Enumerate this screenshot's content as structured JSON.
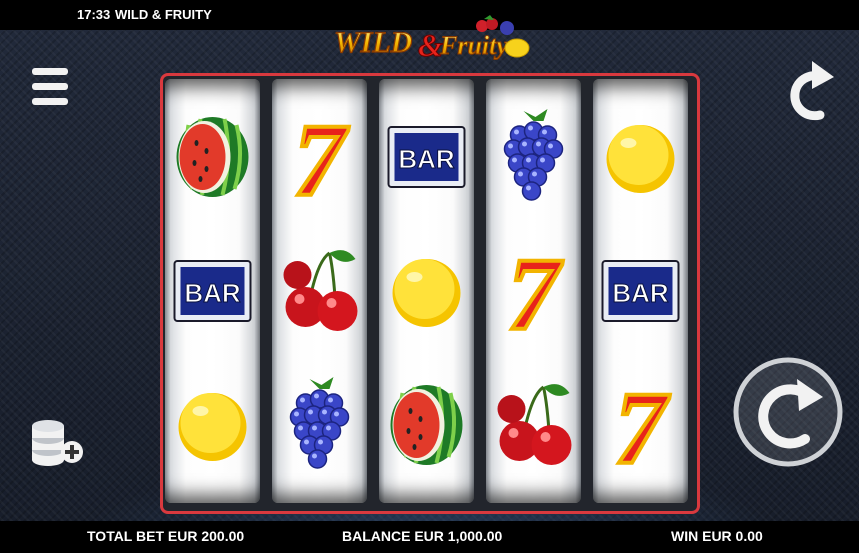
{
  "status_bar": {
    "time": "17:33",
    "game_title": "WILD & FRUITY"
  },
  "logo": {
    "text_wild": "WILD",
    "text_amp": "&",
    "text_fruity": "Fruity"
  },
  "reels": [
    [
      "watermelon",
      "bar",
      "lemon"
    ],
    [
      "seven",
      "cherry",
      "blueberry"
    ],
    [
      "bar",
      "lemon",
      "watermelon"
    ],
    [
      "blueberry",
      "seven",
      "cherry"
    ],
    [
      "lemon",
      "bar",
      "seven"
    ]
  ],
  "symbol_labels": {
    "bar": "BAR",
    "seven": "7"
  },
  "footer": {
    "total_bet": "TOTAL BET EUR 200.00",
    "balance": "BALANCE EUR 1,000.00",
    "win": "WIN EUR 0.00"
  },
  "colors": {
    "frame_red": "#d9393e",
    "bar_blue": "#1a2a8a",
    "seven_red": "#e8231b"
  },
  "icons": [
    "hamburger-menu-icon",
    "restart-arrow-icon",
    "coins-plus-icon",
    "spin-arrow-icon"
  ]
}
